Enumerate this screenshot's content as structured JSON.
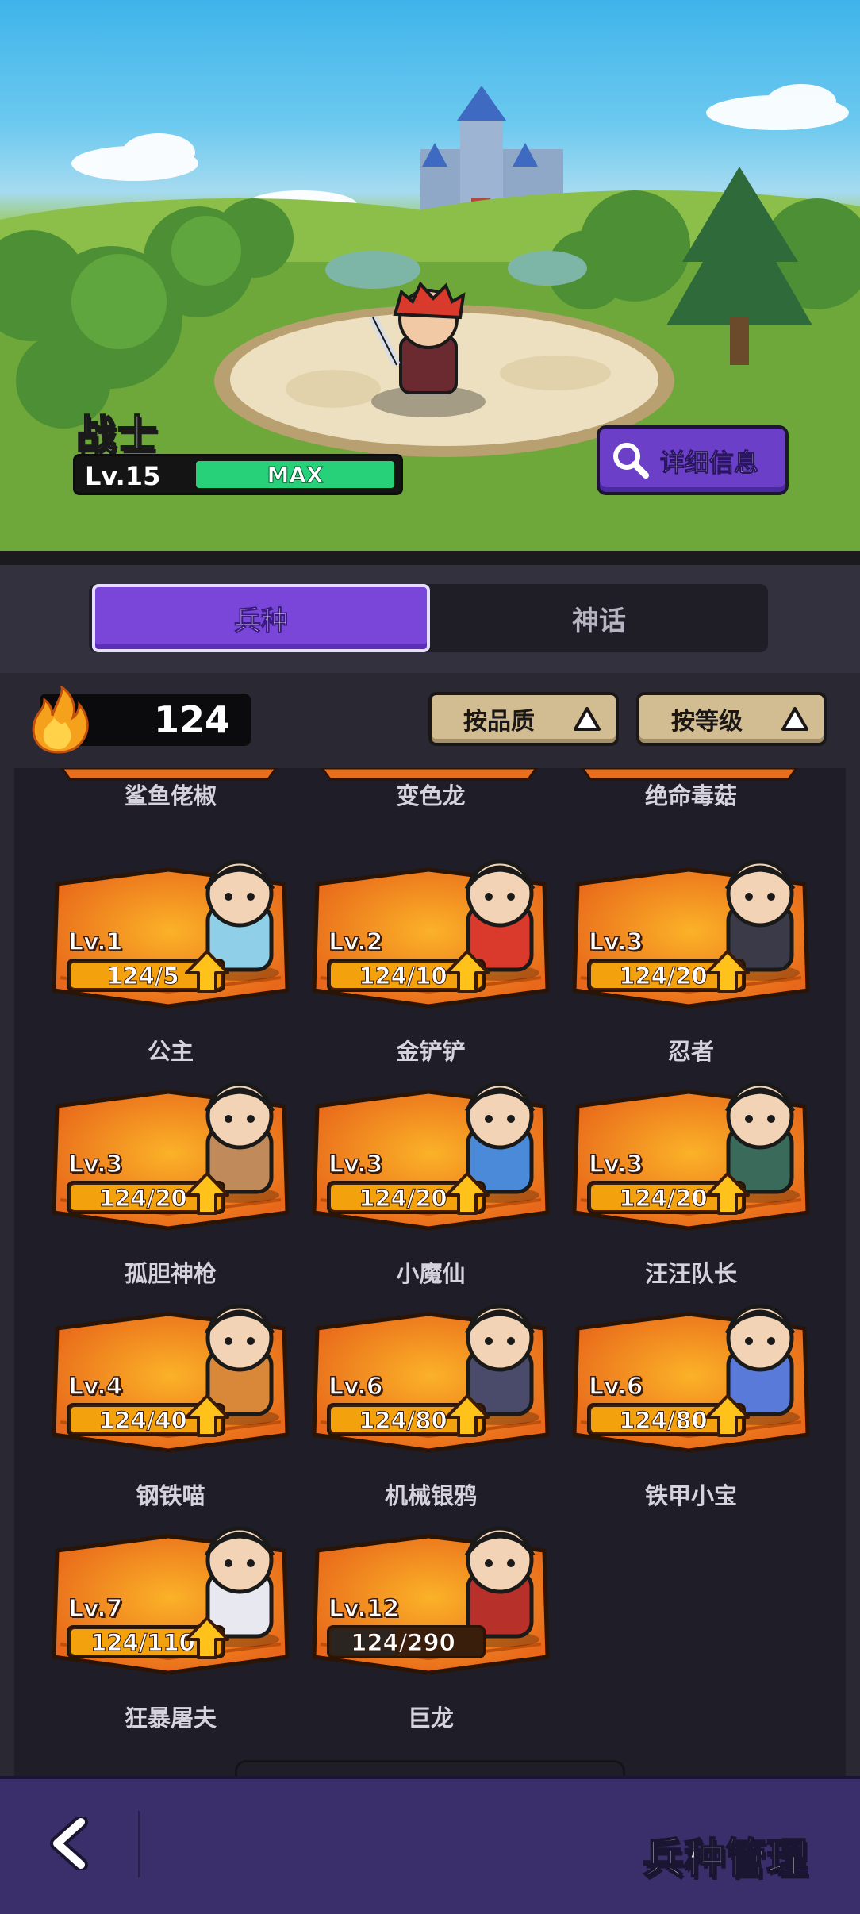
{
  "hero": {
    "name": "战士",
    "level": "Lv.15",
    "level_status": "MAX",
    "detail_button": "详细信息"
  },
  "tabs": [
    {
      "label": "兵种",
      "active": true
    },
    {
      "label": "神话",
      "active": false
    }
  ],
  "resource": {
    "icon": "fire-icon",
    "count": "124"
  },
  "sort_buttons": [
    {
      "label": "按品质",
      "icon": "triangle-up-icon"
    },
    {
      "label": "按等级",
      "icon": "triangle-up-icon"
    }
  ],
  "units_partial_row": [
    {
      "name": "鲨鱼佬椒"
    },
    {
      "name": "变色龙"
    },
    {
      "name": "绝命毒菇"
    }
  ],
  "units": [
    {
      "name": "公主",
      "level": "Lv.1",
      "progress": "124/5",
      "fill": 1.0,
      "upgradable": true
    },
    {
      "name": "金铲铲",
      "level": "Lv.2",
      "progress": "124/10",
      "fill": 1.0,
      "upgradable": true
    },
    {
      "name": "忍者",
      "level": "Lv.3",
      "progress": "124/20",
      "fill": 1.0,
      "upgradable": true
    },
    {
      "name": "孤胆神枪",
      "level": "Lv.3",
      "progress": "124/20",
      "fill": 1.0,
      "upgradable": true
    },
    {
      "name": "小魔仙",
      "level": "Lv.3",
      "progress": "124/20",
      "fill": 1.0,
      "upgradable": true
    },
    {
      "name": "汪汪队长",
      "level": "Lv.3",
      "progress": "124/20",
      "fill": 1.0,
      "upgradable": true
    },
    {
      "name": "钢铁喵",
      "level": "Lv.4",
      "progress": "124/40",
      "fill": 1.0,
      "upgradable": true
    },
    {
      "name": "机械银鸦",
      "level": "Lv.6",
      "progress": "124/80",
      "fill": 1.0,
      "upgradable": true
    },
    {
      "name": "铁甲小宝",
      "level": "Lv.6",
      "progress": "124/80",
      "fill": 1.0,
      "upgradable": true
    },
    {
      "name": "狂暴屠夫",
      "level": "Lv.7",
      "progress": "124/110",
      "fill": 1.0,
      "upgradable": true
    },
    {
      "name": "巨龙",
      "level": "Lv.12",
      "progress": "124/290",
      "fill": 0.43,
      "upgradable": false
    }
  ],
  "footer": {
    "title": "兵种管理",
    "back_icon": "chevron-left-icon"
  },
  "colors": {
    "accent": "#7a46d9",
    "card": "#f07a1a",
    "progress": "#f3a10c",
    "level_max": "#27d17a"
  }
}
